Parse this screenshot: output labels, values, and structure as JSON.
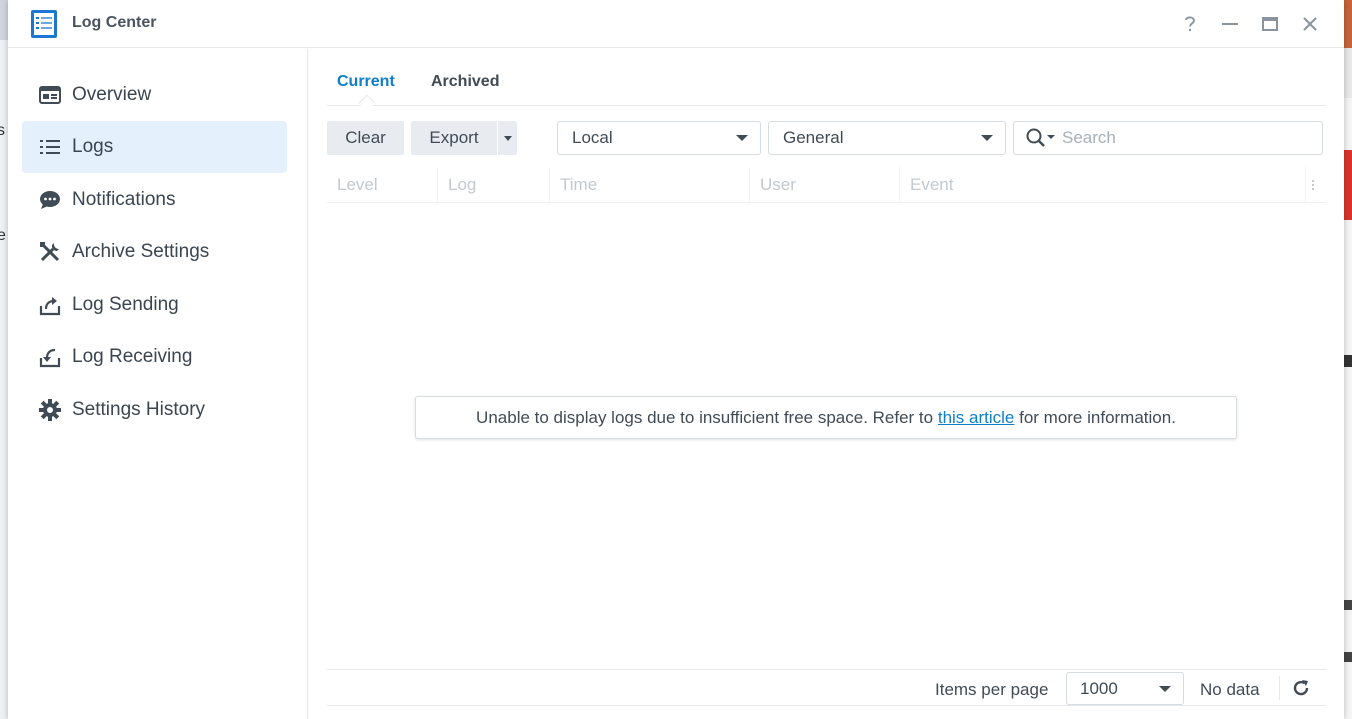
{
  "window": {
    "title": "Log Center",
    "controls": [
      "help-icon",
      "minimize-icon",
      "maximize-icon",
      "close-icon"
    ]
  },
  "sidebar": {
    "items": [
      {
        "label": "Overview",
        "icon": "overview-card-icon",
        "active": false
      },
      {
        "label": "Logs",
        "icon": "list-icon",
        "active": true
      },
      {
        "label": "Notifications",
        "icon": "chat-bubble-icon",
        "active": false
      },
      {
        "label": "Archive Settings",
        "icon": "tools-icon",
        "active": false
      },
      {
        "label": "Log Sending",
        "icon": "upload-icon",
        "active": false
      },
      {
        "label": "Log Receiving",
        "icon": "download-icon",
        "active": false
      },
      {
        "label": "Settings History",
        "icon": "gear-icon",
        "active": false
      }
    ]
  },
  "tabs": {
    "current": "Current",
    "archived": "Archived",
    "active": "Current"
  },
  "toolbar": {
    "clear": "Clear",
    "export": "Export",
    "source_select": "Local",
    "type_select": "General",
    "search_placeholder": "Search"
  },
  "grid": {
    "columns": [
      "Level",
      "Log",
      "Time",
      "User",
      "Event"
    ]
  },
  "notice": {
    "prefix": "Unable to display logs due to insufficient free space. Refer to ",
    "link": "this article",
    "suffix": " for more information."
  },
  "footer": {
    "items_per_page_label": "Items per page",
    "items_per_page_value": "1000",
    "status": "No data"
  },
  "colors": {
    "accent": "#0f7ec9",
    "active_nav_bg": "#e4f0fc",
    "text": "#414b55"
  }
}
